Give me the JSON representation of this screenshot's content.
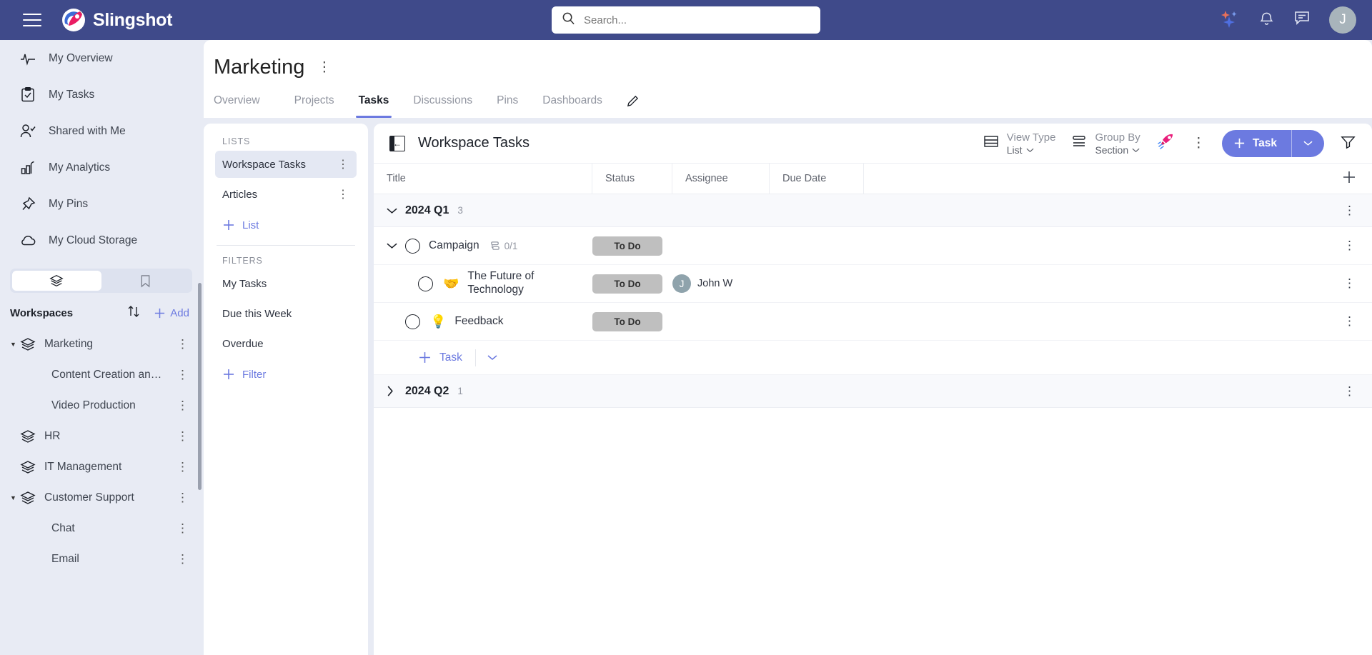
{
  "topbar": {
    "brand": "Slingshot",
    "search_placeholder": "Search...",
    "avatar_initial": "J"
  },
  "sidebar": {
    "nav": [
      {
        "label": "My Overview",
        "icon": "pulse-icon"
      },
      {
        "label": "My Tasks",
        "icon": "clipboard-check-icon"
      },
      {
        "label": "Shared with Me",
        "icon": "person-check-icon"
      },
      {
        "label": "My Analytics",
        "icon": "bar-chart-icon"
      },
      {
        "label": "My Pins",
        "icon": "pin-icon"
      },
      {
        "label": "My Cloud Storage",
        "icon": "cloud-icon"
      }
    ],
    "workspaces_title": "Workspaces",
    "add_label": "Add",
    "workspaces": [
      {
        "label": "Marketing",
        "type": "workspace",
        "expanded": true
      },
      {
        "label": "Content Creation an…",
        "type": "child"
      },
      {
        "label": "Video Production",
        "type": "child"
      },
      {
        "label": "HR",
        "type": "workspace",
        "expanded": false
      },
      {
        "label": "IT Management",
        "type": "workspace",
        "expanded": false
      },
      {
        "label": "Customer Support",
        "type": "workspace",
        "expanded": true
      },
      {
        "label": "Chat",
        "type": "child"
      },
      {
        "label": "Email",
        "type": "child"
      }
    ]
  },
  "page": {
    "title": "Marketing",
    "tabs": [
      {
        "label": "Overview",
        "active": false
      },
      {
        "label": "Projects",
        "active": false
      },
      {
        "label": "Tasks",
        "active": true
      },
      {
        "label": "Discussions",
        "active": false
      },
      {
        "label": "Pins",
        "active": false
      },
      {
        "label": "Dashboards",
        "active": false
      }
    ]
  },
  "lists_panel": {
    "lists_label": "LISTS",
    "lists": [
      {
        "label": "Workspace Tasks",
        "selected": true
      },
      {
        "label": "Articles",
        "selected": false
      }
    ],
    "add_list_label": "List",
    "filters_label": "FILTERS",
    "filters": [
      {
        "label": "My Tasks"
      },
      {
        "label": "Due this Week"
      },
      {
        "label": "Overdue"
      }
    ],
    "add_filter_label": "Filter"
  },
  "task_panel": {
    "title": "Workspace Tasks",
    "view_type_label": "View Type",
    "view_type_value": "List",
    "group_by_label": "Group By",
    "group_by_value": "Section",
    "new_task_label": "Task",
    "columns": [
      "Title",
      "Status",
      "Assignee",
      "Due Date"
    ],
    "groups": [
      {
        "name": "2024 Q1",
        "count": "3",
        "expanded": true,
        "rows": [
          {
            "title": "Campaign",
            "level": 1,
            "has_caret": true,
            "emoji": "",
            "subtask_count": "0/1",
            "status": "To Do",
            "assignee": "",
            "assignee_initial": "",
            "due_date": ""
          },
          {
            "title": "The Future of Technology",
            "level": 2,
            "has_caret": false,
            "emoji": "🤝",
            "subtask_count": "",
            "status": "To Do",
            "assignee": "John W",
            "assignee_initial": "J",
            "due_date": ""
          },
          {
            "title": "Feedback",
            "level": 1,
            "has_caret": false,
            "emoji": "💡",
            "subtask_count": "",
            "status": "To Do",
            "assignee": "",
            "assignee_initial": "",
            "due_date": ""
          }
        ],
        "add_task_label": "Task"
      },
      {
        "name": "2024 Q2",
        "count": "1",
        "expanded": false,
        "rows": [],
        "add_task_label": ""
      }
    ]
  },
  "colors": {
    "topbar": "#3f4a8a",
    "accent": "#6c7ae0",
    "page_bg": "#e8ebf4",
    "status_pill": "#bfbfbf"
  }
}
